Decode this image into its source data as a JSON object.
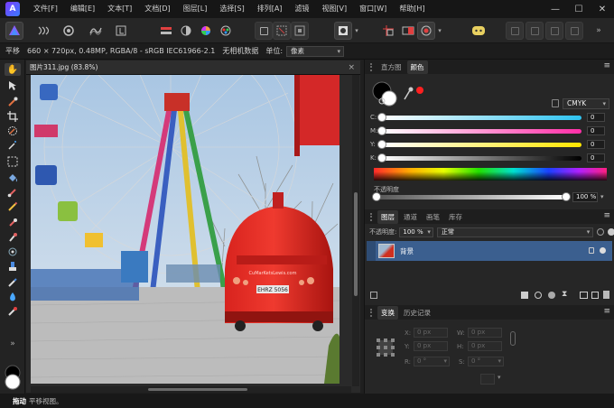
{
  "menubar": {
    "items": [
      "文件[F]",
      "编辑[E]",
      "文本[T]",
      "文档[D]",
      "图层[L]",
      "选择[S]",
      "排列[A]",
      "滤镜",
      "视图[V]",
      "窗口[W]",
      "帮助[H]"
    ],
    "minimize": "—",
    "maximize": "☐",
    "close": "✕"
  },
  "contextbar": {
    "tool": "平移",
    "info": "660 × 720px, 0.48MP, RGBA/8 - sRGB IEC61966-2.1",
    "metadata": "无相机数据",
    "unit_label": "单位:",
    "unit_value": "像素"
  },
  "document": {
    "tab_title": "图片311.jpg (83.8%)",
    "close": "×",
    "bus_sign": "EHRZ 5056",
    "bus_text": "CuMarKetsLewis.com"
  },
  "statusbar": {
    "bold": "拖动",
    "text": "平移视图。"
  },
  "color_panel": {
    "tabs": [
      "直方图",
      "颜色"
    ],
    "active_tab": "颜色",
    "model": "CMYK",
    "channels": [
      {
        "label": "C:",
        "value": "0"
      },
      {
        "label": "M:",
        "value": "0"
      },
      {
        "label": "Y:",
        "value": "0"
      },
      {
        "label": "K:",
        "value": "0"
      }
    ],
    "opacity_label": "不透明度",
    "opacity_value": "100 %",
    "colors": {
      "cyan": "#2ec3f0",
      "magenta": "#ff2fa8",
      "yellow": "#ffe600",
      "key": "#000000",
      "accent_red": "#ff2020"
    }
  },
  "layers_panel": {
    "tabs": [
      "图层",
      "通道",
      "画笔",
      "库存"
    ],
    "active_tab": "图层",
    "opacity_label": "不透明度:",
    "opacity_value": "100 %",
    "blend_mode": "正常",
    "layers": [
      {
        "name": "背景",
        "selected": true
      }
    ]
  },
  "transform_panel": {
    "tabs": [
      "变换",
      "历史记录"
    ],
    "active_tab": "变换",
    "x_label": "X:",
    "x_value": "0 px",
    "y_label": "Y:",
    "y_value": "0 px",
    "w_label": "W:",
    "w_value": "0 px",
    "h_label": "H:",
    "h_value": "0 px",
    "r_label": "R:",
    "r_value": "0 °",
    "s_label": "S:",
    "s_value": "0 °"
  }
}
